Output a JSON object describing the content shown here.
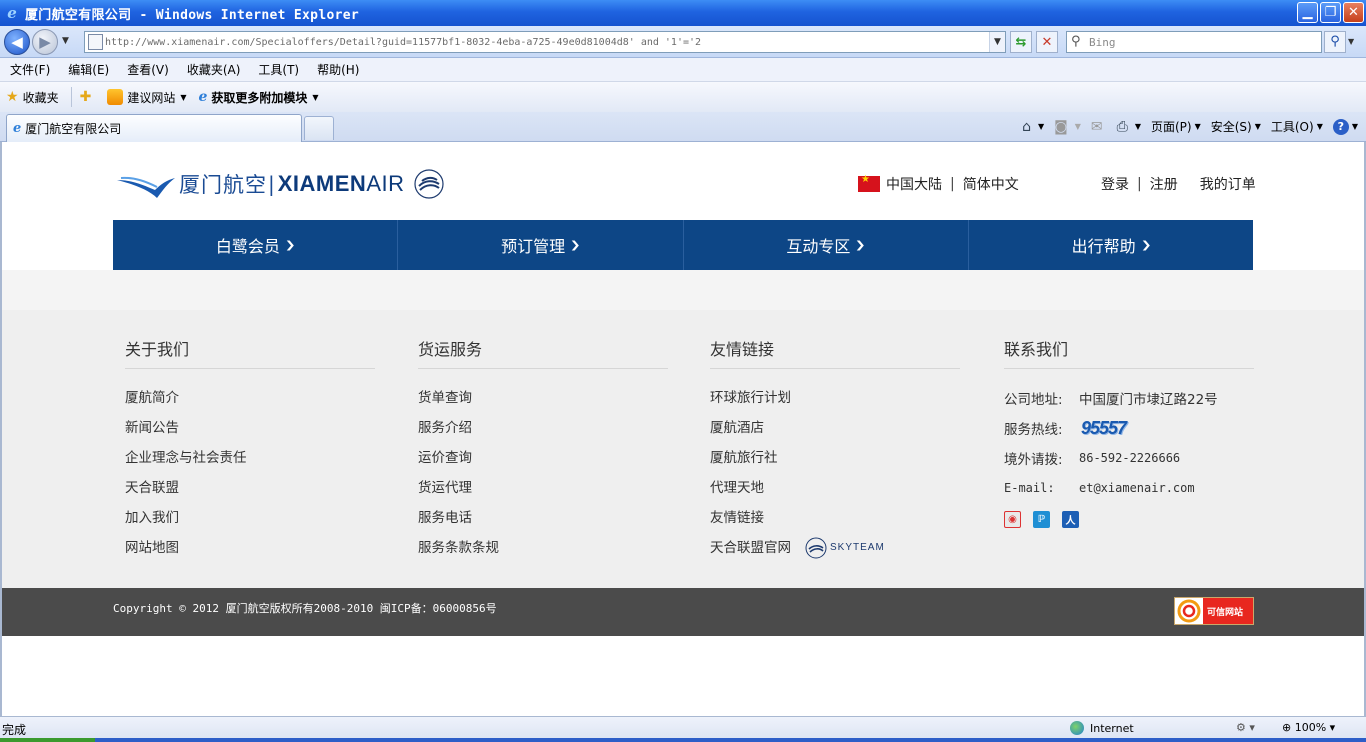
{
  "window": {
    "title": "厦门航空有限公司 - Windows Internet Explorer",
    "minimize": "▁",
    "maximize": "❐",
    "close": "✕"
  },
  "address": {
    "url": "http://www.xiamenair.com/Specialoffers/Detail?guid=11577bf1-8032-4eba-a725-49e0d81004d8' and '1'='2",
    "search_placeholder": "Bing"
  },
  "menu": [
    "文件(F)",
    "编辑(E)",
    "查看(V)",
    "收藏夹(A)",
    "工具(T)",
    "帮助(H)"
  ],
  "favorites": {
    "favorites_label": "收藏夹",
    "suggested_sites": "建议网站",
    "get_addons": "获取更多附加模块"
  },
  "tab": {
    "title": "厦门航空有限公司"
  },
  "commands": {
    "page": "页面(P)",
    "safety": "安全(S)",
    "tools": "工具(O)",
    "help": "?"
  },
  "site": {
    "logo_cn": "厦门航空",
    "logo_en_bold": "XIAMEN",
    "logo_en_light": "AIR",
    "region": "中国大陆",
    "language": "简体中文",
    "login": "登录",
    "register": "注册",
    "orders": "我的订单",
    "nav": [
      "白鹭会员",
      "预订管理",
      "互动专区",
      "出行帮助"
    ]
  },
  "footer": {
    "about": {
      "title": "关于我们",
      "items": [
        "厦航简介",
        "新闻公告",
        "企业理念与社会责任",
        "天合联盟",
        "加入我们",
        "网站地图"
      ]
    },
    "cargo": {
      "title": "货运服务",
      "items": [
        "货单查询",
        "服务介绍",
        "运价查询",
        "货运代理",
        "服务电话",
        "服务条款条规"
      ]
    },
    "links": {
      "title": "友情链接",
      "items": [
        "环球旅行计划",
        "厦航酒店",
        "厦航旅行社",
        "代理天地",
        "友情链接",
        "天合联盟官网"
      ],
      "skyteam_badge": "SKYTEAM"
    },
    "contact": {
      "title": "联系我们",
      "address_label": "公司地址:",
      "address_value": "中国厦门市埭辽路22号",
      "hotline_label": "服务热线:",
      "hotline_value": "95557",
      "overseas_label": "境外请拨:",
      "overseas_value": "86-592-2226666",
      "email_label": "E-mail:",
      "email_value": "et@xiamenair.com"
    },
    "copyright": "Copyright © 2012 厦门航空版权所有2008-2010 闽ICP备：06000856号",
    "credit_badge": "可信网站"
  },
  "status": {
    "text": "完成",
    "zone": "Internet",
    "zoom": "100%"
  },
  "colors": {
    "nav_blue": "#0d4686",
    "footer_dark": "#4b4b4b",
    "footer_light": "#efefef"
  }
}
